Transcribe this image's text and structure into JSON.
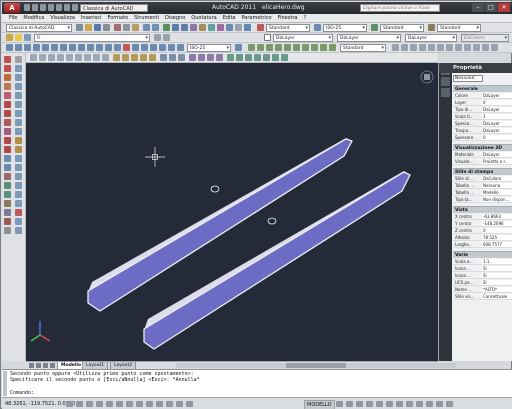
{
  "app": {
    "logo_letter": "A",
    "window_title": "AutoCAD 2011",
    "file_name": "elicaHero.dwg",
    "workspace": "Classica di AutoCAD",
    "help_search_placeholder": "Digitare parola chiave o frase"
  },
  "menu": [
    "File",
    "Modifica",
    "Visualizza",
    "Inserisci",
    "Formato",
    "Strumenti",
    "Disegno",
    "Quotatura",
    "Edita",
    "Parametrico",
    "Finestra",
    "?"
  ],
  "toolbars": {
    "workspace_combo": "Classica di AutoCAD",
    "text_style": "Standard",
    "dim_style": "ISO-25",
    "table_style": "Standard",
    "mleader_style": "Standard",
    "layer_combo": "0",
    "color_combo": "DaLayer",
    "linetype_combo": "DaLayer",
    "lineweight_combo": "DaLayer",
    "plot_style": "DaColore",
    "dim_style_2": "ISO-25",
    "view_combo": "Standard"
  },
  "properties": {
    "title": "Proprietà",
    "selection": "Nessuna",
    "sections": [
      {
        "name": "Generale",
        "rows": [
          {
            "k": "Colore",
            "v": "DaLayer"
          },
          {
            "k": "Layer",
            "v": "0"
          },
          {
            "k": "Tipo di...",
            "v": "DaLayer"
          },
          {
            "k": "Scala ti...",
            "v": "1"
          },
          {
            "k": "Spesso...",
            "v": "DaLayer"
          },
          {
            "k": "Traspa...",
            "v": "DaLayer"
          },
          {
            "k": "Spessore",
            "v": "0"
          }
        ]
      },
      {
        "name": "Visualizzazione 3D",
        "rows": [
          {
            "k": "Materiale",
            "v": "DaLayer"
          },
          {
            "k": "Visuale...",
            "v": "Proietta e r..."
          }
        ]
      },
      {
        "name": "Stile di stampa",
        "rows": [
          {
            "k": "Stile di ...",
            "v": "DaColore"
          },
          {
            "k": "Tabella ...",
            "v": "Nessuna"
          },
          {
            "k": "Tabella ...",
            "v": "Modello"
          },
          {
            "k": "Tipo ta...",
            "v": "Non dispon..."
          }
        ]
      },
      {
        "name": "Vista",
        "rows": [
          {
            "k": "X centro",
            "v": "-63.8663"
          },
          {
            "k": "Y centro",
            "v": "-148.2096"
          },
          {
            "k": "Z centro",
            "v": "0"
          },
          {
            "k": "Altezza",
            "v": "78.525"
          },
          {
            "k": "Larghe...",
            "v": "608.7577"
          }
        ]
      },
      {
        "name": "Varie",
        "rows": [
          {
            "k": "Scala a...",
            "v": "1:1"
          },
          {
            "k": "Icona ...",
            "v": "Sì"
          },
          {
            "k": "Icona ...",
            "v": "Sì"
          },
          {
            "k": "UCS pe...",
            "v": "Sì"
          },
          {
            "k": "Nome ...",
            "v": "*ALTO*"
          },
          {
            "k": "Stile vis...",
            "v": "Concettuale"
          }
        ]
      }
    ]
  },
  "layout_tabs": [
    "Modello",
    "Layout1",
    "Layout2"
  ],
  "command_lines": [
    "Secondo punto oppure <Utilizza primo punto come spostamento>:",
    "Specificare il secondo punto o [Esci/aNnulla] <Esci>: *Annulla*"
  ],
  "command_prompt": "Comando:",
  "status": {
    "coords": "48.3261, -119.7521, 0.0000",
    "model_label": "MODELLO"
  },
  "colors": {
    "viewport_bg": "#242a37",
    "blade_fill": "#6f6fc8",
    "blade_edge": "#f0f0f5"
  }
}
